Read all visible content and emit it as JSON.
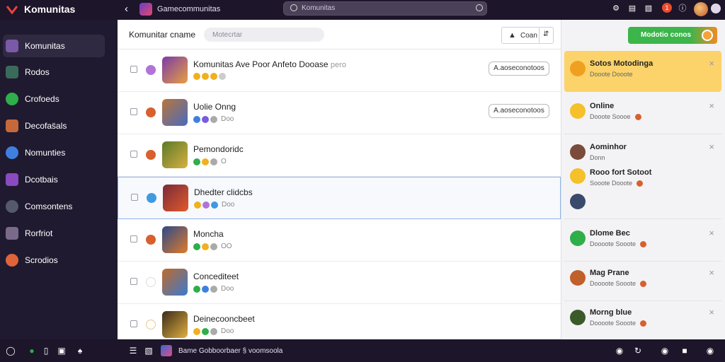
{
  "app": {
    "name": "Komunitas"
  },
  "topbar": {
    "community_name": "Gamecommunitas",
    "search_placeholder": "Komunitas",
    "notif_count": "1"
  },
  "sidebar": {
    "items": [
      {
        "label": "Komunitas",
        "active": true,
        "color": "#7a5aa8"
      },
      {
        "label": "Rodos",
        "active": false,
        "color": "#3a6a5a"
      },
      {
        "label": "Crofoeds",
        "active": false,
        "color": "#2fae4a"
      },
      {
        "label": "Decofas̈als",
        "active": false,
        "color": "#c6693a"
      },
      {
        "label": "Nomunties",
        "active": false,
        "color": "#3f7fe0"
      },
      {
        "label": "Dcotbais",
        "active": false,
        "color": "#8a4ac0"
      },
      {
        "label": "Comsontens",
        "active": false,
        "color": "#555a6a"
      },
      {
        "label": "Rorfriot",
        "active": false,
        "color": "#7a6a8a"
      },
      {
        "label": "Scrodios",
        "active": false,
        "color": "#e0643a"
      }
    ]
  },
  "main": {
    "title": "Komunitar cname",
    "filter_placeholder": "Motecrtar",
    "sort_label": "Coan",
    "rows": [
      {
        "title": "Komunitas Ave Poor Anfeto Dooase",
        "tag": "pero",
        "meta": "",
        "action": "A.aoseconotoos",
        "mark": "#b074d8",
        "thumb": "#7a3aa8"
      },
      {
        "title": "Uolie Onng",
        "tag": "",
        "meta": "Doo",
        "action": "A.aoseconotoos",
        "mark": "#d8602e",
        "thumb": "#b8763a"
      },
      {
        "title": "Pemondoridc",
        "tag": "",
        "meta": "O",
        "action": "",
        "mark": "#d8602e",
        "thumb": "#5a7a2a"
      },
      {
        "title": "Dhedter clidcbs",
        "tag": "",
        "meta": "Doo",
        "action": "",
        "mark": "#3f9ae0",
        "thumb": "#7a2a3a"
      },
      {
        "title": "Moncha",
        "tag": "",
        "meta": "OO",
        "action": "",
        "mark": "#d8602e",
        "thumb": "#2a4a8a"
      },
      {
        "title": "Concediteet",
        "tag": "",
        "meta": "Doo",
        "action": "",
        "mark": "#e0e0e6",
        "thumb": "#c06a2a"
      },
      {
        "title": "Deinecooncbeet",
        "tag": "",
        "meta": "Doo",
        "action": "",
        "mark": "#e8d8a0",
        "thumb": "#3a2a1a"
      }
    ]
  },
  "right": {
    "manage_label": "Modotio conos",
    "cards": [
      {
        "title": "Sotos Motodinga",
        "sub": "Dooote Dooote",
        "alert": true,
        "icon": "#f0a020"
      },
      {
        "title": "Online",
        "sub": "Dooote Soooe",
        "alert": false,
        "icon": "#f5c02a"
      },
      {
        "title": "Aominhor",
        "sub": "Donn",
        "alert": false,
        "icon": "#7a4a3a"
      },
      {
        "title": "Rooo fort Sotoot",
        "sub": "Sooote Dooote",
        "alert": false,
        "icon": "#f5c02a"
      },
      {
        "title": "Dlome Bec",
        "sub": "Doooote Sooote",
        "alert": false,
        "icon": "#2fae4a"
      },
      {
        "title": "Mag Prane",
        "sub": "Doooote Sooote",
        "alert": false,
        "icon": "#c0602a"
      },
      {
        "title": "Morng blue",
        "sub": "Doooote Sooote",
        "alert": false,
        "icon": "#3a5a2a"
      }
    ]
  },
  "bottombar": {
    "status_text": "Bame Gobboorbaer § voomsoola"
  }
}
